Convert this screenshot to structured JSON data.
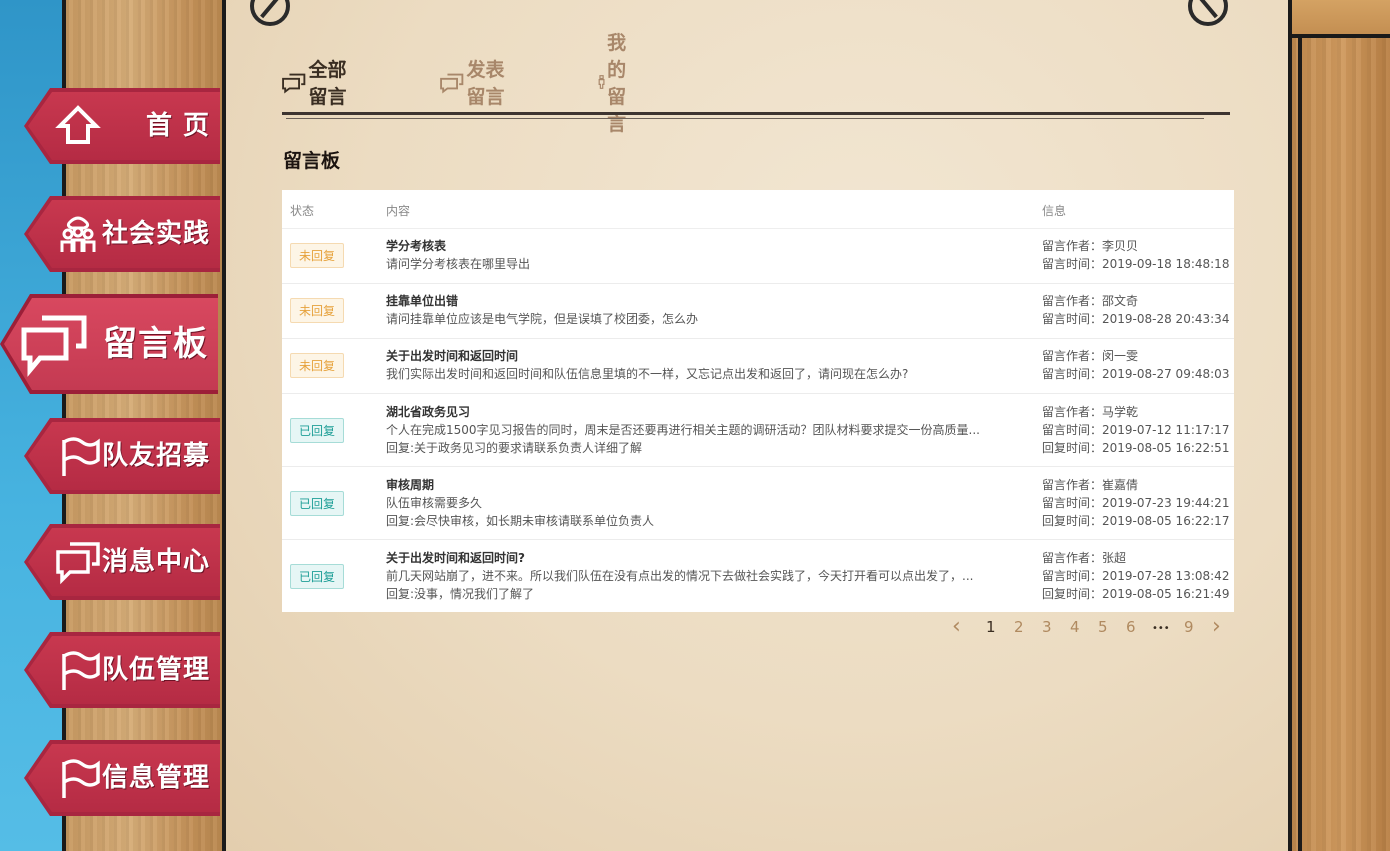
{
  "nav": [
    {
      "label": "首 页",
      "icon": "home-icon"
    },
    {
      "label": "社会实践",
      "icon": "people-icon"
    },
    {
      "label": "留言板",
      "icon": "chat-icon",
      "active": true
    },
    {
      "label": "队友招募",
      "icon": "flag-icon"
    },
    {
      "label": "消息中心",
      "icon": "chat-icon"
    },
    {
      "label": "队伍管理",
      "icon": "flag-icon"
    },
    {
      "label": "信息管理",
      "icon": "flag-icon"
    }
  ],
  "tabs": [
    {
      "label": "全部留言",
      "icon": "chat-icon"
    },
    {
      "label": "发表留言",
      "icon": "chat-icon"
    },
    {
      "label": "我的留言",
      "icon": "person-icon"
    }
  ],
  "board_title": "留言板",
  "table": {
    "headers": {
      "status": "状态",
      "content": "内容",
      "info": "信息"
    },
    "rows": [
      {
        "status": "未回复",
        "replied": false,
        "title": "学分考核表",
        "body": "请问学分考核表在哪里导出",
        "reply": "",
        "author": "留言作者：李贝贝",
        "time": "留言时间：2019-09-18 18:48:18",
        "reply_time": ""
      },
      {
        "status": "未回复",
        "replied": false,
        "title": "挂靠单位出错",
        "body": "请问挂靠单位应该是电气学院，但是误填了校团委，怎么办",
        "reply": "",
        "author": "留言作者：邵文奇",
        "time": "留言时间：2019-08-28 20:43:34",
        "reply_time": ""
      },
      {
        "status": "未回复",
        "replied": false,
        "title": "关于出发时间和返回时间",
        "body": "我们实际出发时间和返回时间和队伍信息里填的不一样，又忘记点出发和返回了，请问现在怎么办?",
        "reply": "",
        "author": "留言作者：闵一雯",
        "time": "留言时间：2019-08-27 09:48:03",
        "reply_time": ""
      },
      {
        "status": "已回复",
        "replied": true,
        "title": "湖北省政务见习",
        "body": "个人在完成1500字见习报告的同时，周末是否还要再进行相关主题的调研活动？团队材料要求提交一份高质量...",
        "reply": "回复:关于政务见习的要求请联系负责人详细了解",
        "author": "留言作者：马学乾",
        "time": "留言时间：2019-07-12 11:17:17",
        "reply_time": "回复时间：2019-08-05 16:22:51"
      },
      {
        "status": "已回复",
        "replied": true,
        "title": "审核周期",
        "body": "队伍审核需要多久",
        "reply": "回复:会尽快审核，如长期未审核请联系单位负责人",
        "author": "留言作者：崔嘉倩",
        "time": "留言时间：2019-07-23 19:44:21",
        "reply_time": "回复时间：2019-08-05 16:22:17"
      },
      {
        "status": "已回复",
        "replied": true,
        "title": "关于出发时间和返回时间?",
        "body": "前几天网站崩了，进不来。所以我们队伍在没有点出发的情况下去做社会实践了，今天打开看可以点出发了，...",
        "reply": "回复:没事，情况我们了解了",
        "author": "留言作者：张超",
        "time": "留言时间：2019-07-28 13:08:42",
        "reply_time": "回复时间：2019-08-05 16:21:49"
      }
    ]
  },
  "pager": {
    "prev": "‹",
    "pages": [
      "1",
      "2",
      "3",
      "4",
      "5",
      "6",
      "•••",
      "9"
    ],
    "next": "›",
    "current": "1"
  },
  "colors": {
    "nav": "#c43a52",
    "paper": "#ecdcc2",
    "replied": "#1f9f97",
    "unreplied": "#e6a23c"
  }
}
